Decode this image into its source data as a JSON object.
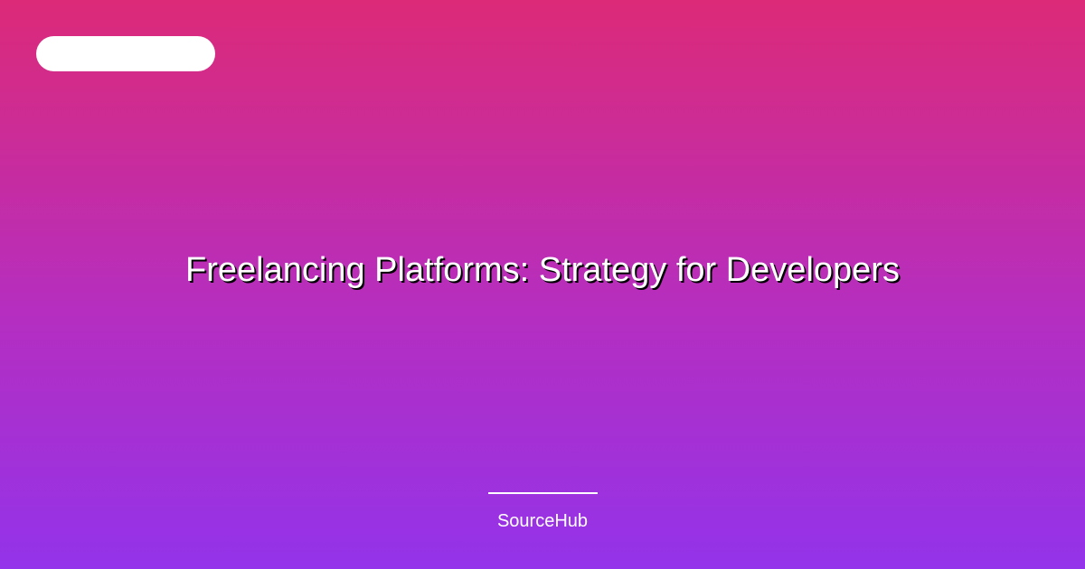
{
  "card": {
    "title": "Freelancing Platforms: Strategy for Developers",
    "brand": "SourceHub"
  },
  "colors": {
    "gradient_top": "#dc2a78",
    "gradient_bottom": "#9333ea",
    "text": "#ffffff"
  }
}
